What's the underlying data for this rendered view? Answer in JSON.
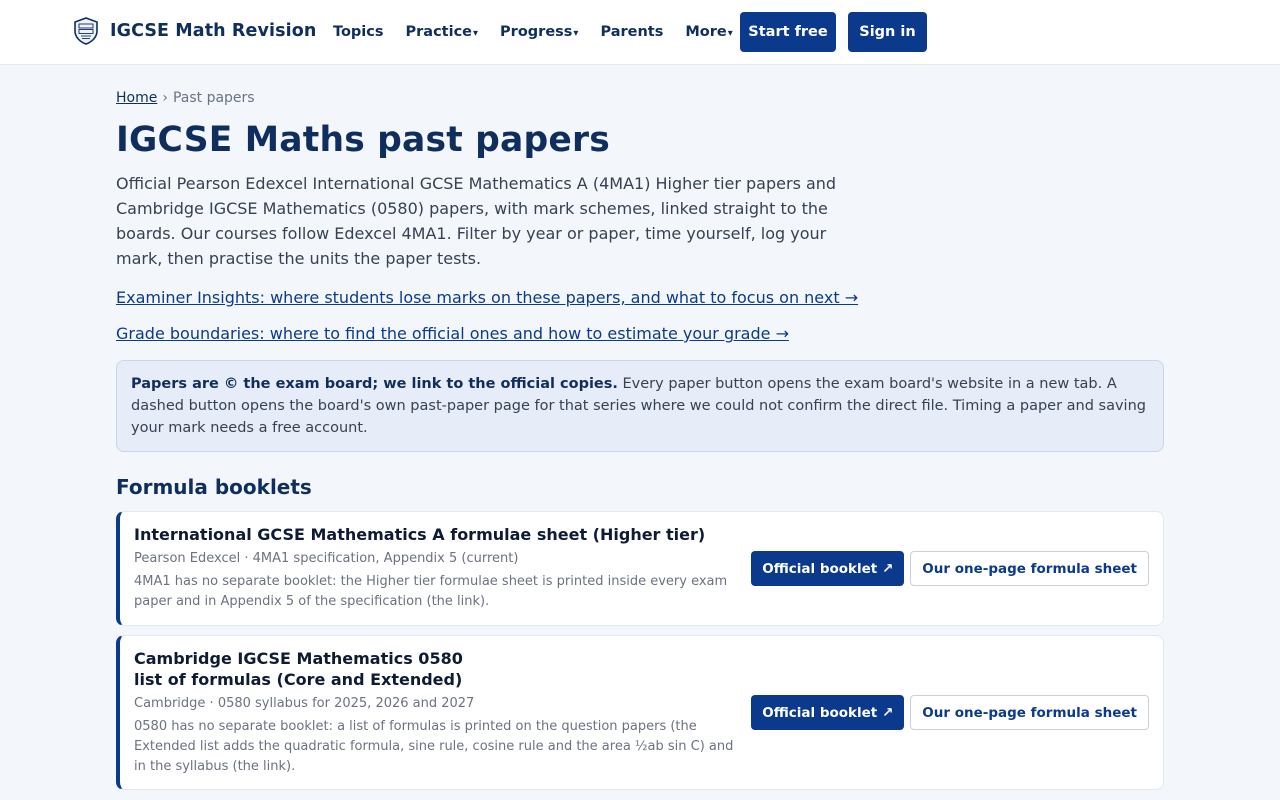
{
  "header": {
    "brand_name": "IGCSE Math Revision",
    "nav": [
      {
        "label": "Topics",
        "caret": ""
      },
      {
        "label": "Practice",
        "caret": "▾"
      },
      {
        "label": "Progress",
        "caret": "▾"
      },
      {
        "label": "Parents",
        "caret": ""
      },
      {
        "label": "More",
        "caret": "▾"
      }
    ],
    "start_label": "Start free",
    "signin_label": "Sign in"
  },
  "breadcrumb": {
    "home": "Home",
    "separator": "›",
    "current": "Past papers"
  },
  "page": {
    "title": "IGCSE Maths past papers",
    "intro": "Official Pearson Edexcel International GCSE Mathematics A (4MA1) Higher tier papers and Cambridge IGCSE Mathematics (0580) papers, with mark schemes, linked straight to the boards. Our courses follow Edexcel 4MA1. Filter by year or paper, time yourself, log your mark, then practise the units the paper tests.",
    "link_insights": "Examiner Insights: where students lose marks on these papers, and what to focus on next →",
    "link_boundaries": "Grade boundaries: where to find the official ones and how to estimate your grade →"
  },
  "notice": {
    "bold": "Papers are © the exam board; we link to the official copies.",
    "text": " Every paper button opens the exam board's website in a new tab. A dashed button opens the board's own past-paper page for that series where we could not confirm the direct file. Timing a paper and saving your mark needs a free account."
  },
  "formula_section": {
    "title": "Formula booklets",
    "cards": [
      {
        "title": "International GCSE Mathematics A formulae sheet (Higher tier)",
        "meta": "Pearson Edexcel · 4MA1 specification, Appendix 5 (current)",
        "desc": "4MA1 has no separate booklet: the Higher tier formulae sheet is printed inside every exam paper and in Appendix 5 of the specification (the link).",
        "official_label": "Official booklet ↗",
        "sheet_label": "Our one-page formula sheet"
      },
      {
        "title_line1": "Cambridge IGCSE Mathematics 0580",
        "title_line2": "list of formulas (Core and Extended)",
        "meta": "Cambridge · 0580 syllabus for 2025, 2026 and 2027",
        "desc": "0580 has no separate booklet: a list of formulas is printed on the question papers (the Extended list adds the quadratic formula, sine rule, cosine rule and the area ½ab sin C) and in the syllabus (the link).",
        "official_label": "Official booklet ↗",
        "sheet_label": "Our one-page formula sheet"
      }
    ]
  }
}
